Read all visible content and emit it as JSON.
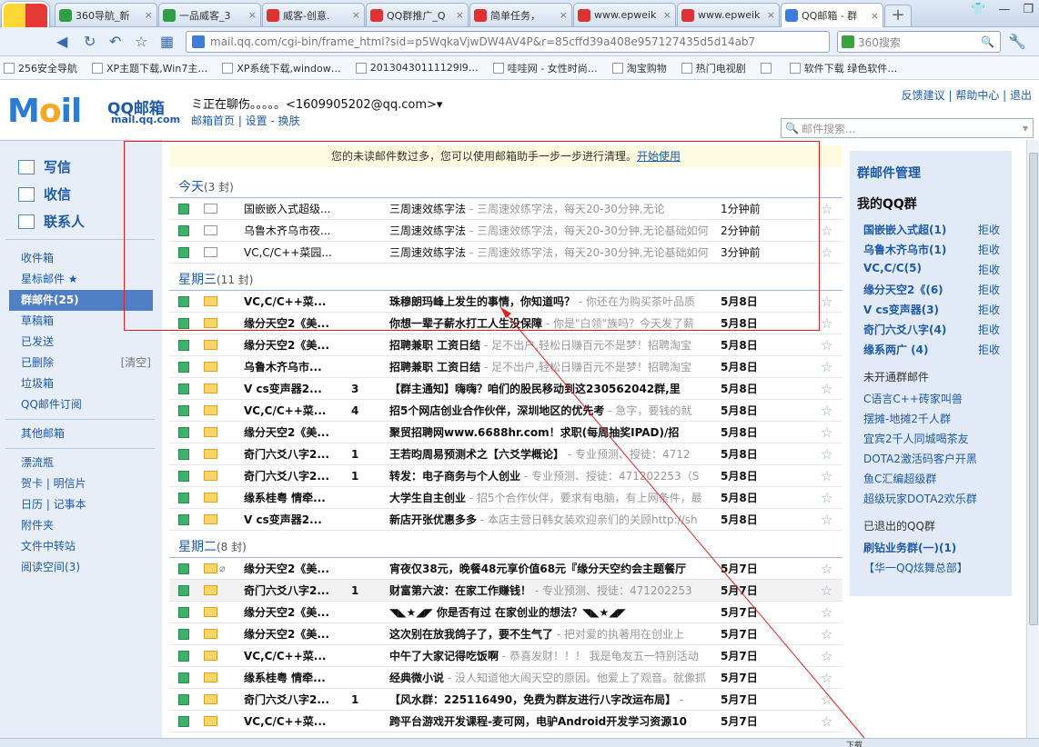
{
  "browser": {
    "tabs": [
      {
        "title": "360导航_新",
        "icon": "navigation-icon",
        "color": "#2f9e44"
      },
      {
        "title": "一品威客_3",
        "icon": "search-icon",
        "color": "#2f9e44"
      },
      {
        "title": "威客-创意.",
        "icon": "paw-icon",
        "color": "#d33"
      },
      {
        "title": "QQ群推广_Q",
        "icon": "paw-icon",
        "color": "#d33"
      },
      {
        "title": "简单任务，",
        "icon": "paw-icon",
        "color": "#d33"
      },
      {
        "title": "www.epweik",
        "icon": "paw-icon",
        "color": "#d33"
      },
      {
        "title": "www.epweik",
        "icon": "paw-icon",
        "color": "#d33"
      },
      {
        "title": "QQ邮箱 - 群",
        "icon": "qq-icon",
        "color": "#3b7dd8"
      }
    ],
    "address": "mail.qq.com/cgi-bin/frame_html?sid=p5WqkaVjwDW4AV4P&r=85cffd39a408e957127435d5d14ab7",
    "search_placeholder": "360搜索",
    "bookmarks": [
      "256安全导航",
      "XP主题下载,Win7主…",
      "XP系统下载,window…",
      "20130430111129l9…",
      "哇哇网 - 女性时尚…",
      "淘宝购物",
      "热门电视剧",
      "",
      "软件下载 绿色软件…"
    ]
  },
  "mail": {
    "logo_word_m": "M",
    "logo_word_o": "o",
    "logo_word_il": "il",
    "logo_name": "QQ邮箱",
    "logo_domain": "mail.qq.com",
    "user": "ミ正在聊伤。。。。。<1609905202@qq.com>▾",
    "user_links": "邮箱首页 | 设置 - 换肤",
    "top_links": "反馈建议 | 帮助中心 | 退出",
    "search_placeholder": "邮件搜索..."
  },
  "left": {
    "compose": "写信",
    "inbox_check": "收信",
    "contacts": "联系人",
    "nav": [
      {
        "label": "收件箱"
      },
      {
        "label": "星标邮件 ★"
      },
      {
        "label": "群邮件(25)",
        "active": true
      },
      {
        "label": "草稿箱"
      },
      {
        "label": "已发送"
      },
      {
        "label": "已删除",
        "extra": "[清空]"
      },
      {
        "label": "垃圾箱"
      },
      {
        "label": "QQ邮件订阅"
      },
      {
        "label": ""
      },
      {
        "label": "其他邮箱"
      },
      {
        "label": ""
      },
      {
        "label": "漂流瓶"
      },
      {
        "label": "贺卡 | 明信片"
      },
      {
        "label": "日历 | 记事本"
      },
      {
        "label": "附件夹"
      },
      {
        "label": "文件中转站"
      },
      {
        "label": "阅读空间(3)"
      }
    ]
  },
  "banner": {
    "text": "您的未读邮件数过多，您可以使用邮箱助手一步一步进行清理。",
    "link": "开始使用"
  },
  "groups": [
    {
      "label": "今天",
      "count": "(3 封)"
    },
    {
      "label": "星期三",
      "count": "(11 封)"
    },
    {
      "label": "星期二",
      "count": "(8 封)"
    }
  ],
  "emails": [
    {
      "from": "国嵌嵌入式超级...",
      "num": "",
      "subject": "三周速效练字法",
      "preview": " -          三周速效练字法，每天20-30分钟,无论",
      "date": "1分钟前",
      "bold": false,
      "new": false
    },
    {
      "from": "乌鲁木齐乌市夜...",
      "num": "",
      "subject": "三周速效练字法",
      "preview": " - 三周速效练字法，每天20-30分钟,无论基础如何",
      "date": "2分钟前",
      "bold": false,
      "new": false
    },
    {
      "from": "VC,C/C++菜园...",
      "num": "",
      "subject": "三周速效练字法",
      "preview": " - 三周速效练字法，每天20-30分钟,无论基础如何",
      "date": "3分钟前",
      "bold": false,
      "new": false
    },
    {
      "from": "VC,C/C++菜...",
      "num": "",
      "subject": "珠穆朗玛峰上发生的事情，你知道吗？",
      "preview": " - 你还在为购买茶叶品质",
      "date": "5月8日",
      "bold": true,
      "new": true
    },
    {
      "from": "缘分天空2《美...",
      "num": "",
      "subject": "你想一辈子薪水打工人生没保障",
      "preview": " - 你是\"白领\"族吗？今天发了薪",
      "date": "5月8日",
      "bold": true,
      "new": true
    },
    {
      "from": "缘分天空2《美...",
      "num": "",
      "subject": "招聘兼职  工资日结",
      "preview": " - 足不出户,轻松日赚百元不是梦！招聘淘宝",
      "date": "5月8日",
      "bold": true,
      "new": true
    },
    {
      "from": "乌鲁木齐乌市...",
      "num": "",
      "subject": "招聘兼职  工资日结",
      "preview": " - 足不出户,轻松日赚百元不是梦！招聘淘宝",
      "date": "5月8日",
      "bold": true,
      "new": true
    },
    {
      "from": "V cs变声器2...",
      "num": "3",
      "subject": "【群主通知】嗨嗨？咱们的股民移动到这230562042群,里",
      "preview": "",
      "date": "5月8日",
      "bold": true,
      "new": true
    },
    {
      "from": "VC,C/C++菜...",
      "num": "4",
      "subject": "招5个网店创业合作伙伴，深圳地区的优先考",
      "preview": " - 急字，要钱的就",
      "date": "5月8日",
      "bold": true,
      "new": true
    },
    {
      "from": "缘分天空2《美...",
      "num": "",
      "subject": "聚贸招聘网www.6688hr.com！求职(每周抽奖IPAD)/招",
      "preview": "",
      "date": "5月8日",
      "bold": true,
      "new": true
    },
    {
      "from": "奇门六爻八字2...",
      "num": "1",
      "subject": "王若昀周易预测术之【六爻学概论】",
      "preview": " - 专业预测、授徒：4712",
      "date": "5月8日",
      "bold": true,
      "new": true
    },
    {
      "from": "奇门六爻八字2...",
      "num": "1",
      "subject": "转发：电子商务与个人创业",
      "preview": " - 专业预测、授徒：471202253（S",
      "date": "5月8日",
      "bold": true,
      "new": true
    },
    {
      "from": "缘系桂粤  情牵...",
      "num": "",
      "subject": "大学生自主创业",
      "preview": " - 招5个合作伙伴，要求有电脑，有上网条件，最",
      "date": "5月8日",
      "bold": true,
      "new": true
    },
    {
      "from": "V cs变声器2...",
      "num": "",
      "subject": "新店开张优惠多多",
      "preview": " - 本店主营日韩女装欢迎亲们的关顾http://sh",
      "date": "5月8日",
      "bold": true,
      "new": true
    },
    {
      "from": "缘分天空2《美...",
      "num": "",
      "subject": "宵夜仅38元，晚餐48元享价值68元『缘分天空约会主题餐厅",
      "preview": "",
      "date": "5月7日",
      "bold": true,
      "new": true,
      "clip": true
    },
    {
      "from": "奇门六爻八字2...",
      "num": "1",
      "subject": "财富第六波：在家工作赚钱！",
      "preview": "      - 专业预测、授徒：471202253",
      "date": "5月7日",
      "bold": true,
      "new": true,
      "hl": true
    },
    {
      "from": "缘分天空2《美...",
      "num": "",
      "subject": "◥◣★◢◤ 你是否有过 在家创业的想法？◥◣★◢◤",
      "preview": "",
      "date": "5月7日",
      "bold": true,
      "new": true
    },
    {
      "from": "缘分天空2《美...",
      "num": "",
      "subject": "这次别在放我鸽子了，要不生气了",
      "preview": " - 把对爱的执著用在创业上",
      "date": "5月7日",
      "bold": true,
      "new": true
    },
    {
      "from": "VC,C/C++菜...",
      "num": "",
      "subject": "中午了大家记得吃饭啊",
      "preview": " - 恭喜发财！！！  我是龟友五一特别活动",
      "date": "5月7日",
      "bold": true,
      "new": true
    },
    {
      "from": "缘系桂粤  情牵...",
      "num": "",
      "subject": "经典微小说",
      "preview": " - 没人知道他大闹天空的原因。他爱上了观音。就像抓",
      "date": "5月7日",
      "bold": true,
      "new": true
    },
    {
      "from": "奇门六爻八字2...",
      "num": "1",
      "subject": "【风水群：225116490，免费为群友进行八字改运布局】",
      "preview": " -",
      "date": "5月7日",
      "bold": true,
      "new": true
    },
    {
      "from": "VC,C/C++菜...",
      "num": "",
      "subject": "跨平台游戏开发课程-麦可网，电驴Android开发学习资源10",
      "preview": "",
      "date": "5月7日",
      "bold": true,
      "new": true
    }
  ],
  "right": {
    "title": "群邮件管理",
    "my_groups": "我的QQ群",
    "groups": [
      {
        "name": "国嵌嵌入式超(1)",
        "action": "拒收"
      },
      {
        "name": "乌鲁木齐乌市(1)",
        "action": "拒收"
      },
      {
        "name": "VC,C/C(5)",
        "action": "拒收"
      },
      {
        "name": "缘分天空2《(6)",
        "action": "拒收"
      },
      {
        "name": "V cs变声器(3)",
        "action": "拒收"
      },
      {
        "name": "奇门六爻八字(4)",
        "action": "拒收"
      },
      {
        "name": "缘系两广 (4)",
        "action": "拒收"
      }
    ],
    "unopened_title": "未开通群邮件",
    "unopened": [
      "C语言C++砖家叫兽",
      "摆摊-地摊2千人群",
      "宜宾2千人同城喝茶友",
      "DOTA2激活码客户开黑",
      "鱼C汇编超级群",
      "超级玩家DOTA2欢乐群"
    ],
    "exited_title": "已退出的QQ群",
    "exited": [
      "刷钻业务群(一)(1)",
      "【华一QQ炫舞总部】"
    ]
  },
  "status": {
    "download": "下载"
  }
}
